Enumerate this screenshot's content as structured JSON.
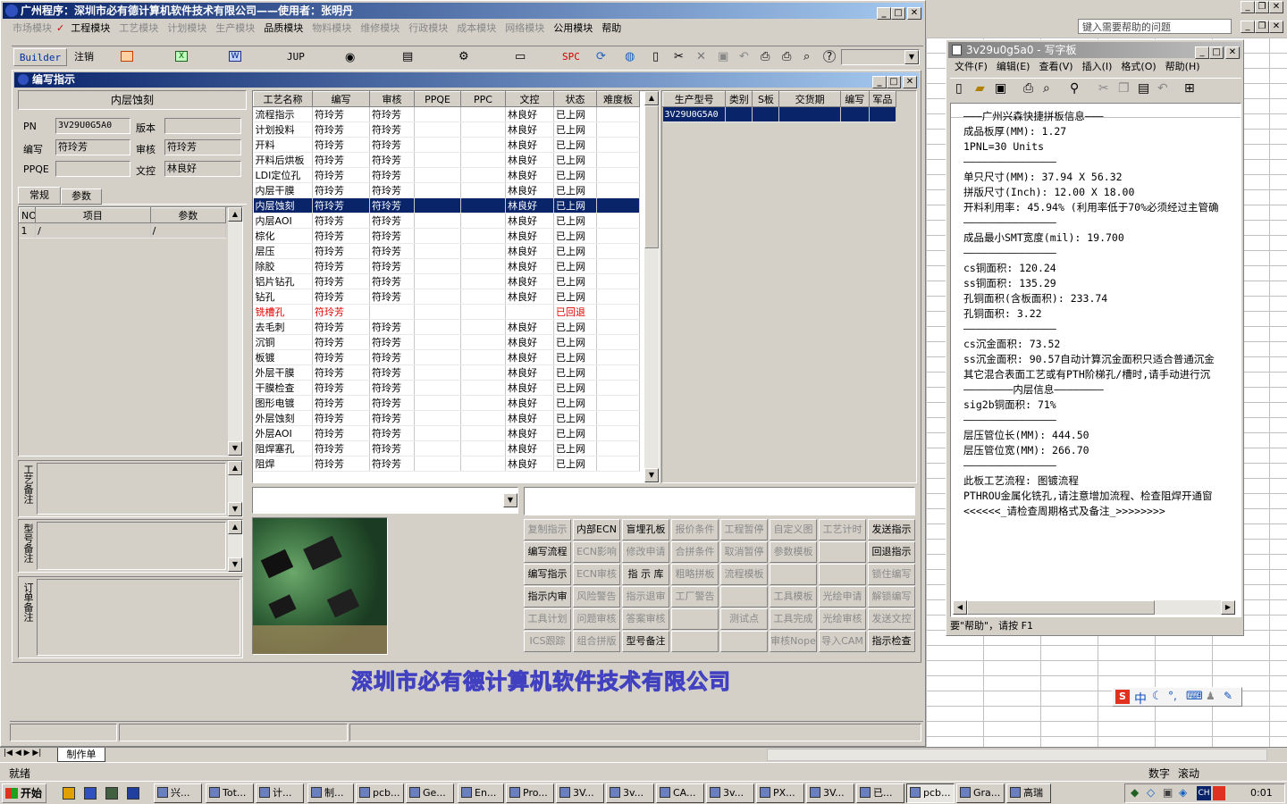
{
  "main_window": {
    "title": "广州程序：深圳市必有德计算机软件技术有限公司——使用者：张明丹",
    "menu": [
      "市场模块",
      "工程模块",
      "工艺模块",
      "计划模块",
      "生产模块",
      "品质模块",
      "物料模块",
      "维修模块",
      "行政模块",
      "成本模块",
      "网络模块",
      "公用模块",
      "帮助"
    ],
    "menu_enabled": [
      false,
      true,
      false,
      false,
      false,
      true,
      false,
      false,
      false,
      false,
      false,
      true,
      true
    ],
    "toolbar": {
      "builder": "Builder",
      "zhuxiao": "注销",
      "jup": "JUP",
      "spc": "SPC"
    }
  },
  "editor": {
    "title": "编写指示",
    "process_label": "内层蚀刻",
    "form": {
      "pn_label": "PN",
      "pn_value": "3V29U0G5A0",
      "version_label": "版本",
      "version_value": "",
      "writer_label": "编写",
      "writer_value": "符玲芳",
      "reviewer_label": "审核",
      "reviewer_value": "符玲芳",
      "ppqe_label": "PPQE",
      "ppqe_value": "",
      "wenkong_label": "文控",
      "wenkong_value": "林良好"
    },
    "tabs": [
      "常规",
      "参数"
    ],
    "param_table": {
      "headers": [
        "NO",
        "项目",
        "参数"
      ],
      "rows": [
        [
          "1",
          "/",
          "/"
        ]
      ]
    },
    "notes": [
      "工艺备注",
      "型号备注",
      "订单备注"
    ]
  },
  "process_table": {
    "headers": [
      "工艺名称",
      "编写",
      "审核",
      "PPQE",
      "PPC",
      "文控",
      "状态",
      "难度板"
    ],
    "rows": [
      {
        "name": "流程指示",
        "writer": "符玲芳",
        "reviewer": "符玲芳",
        "ppqe": "",
        "ppc": "",
        "wenkong": "林良好",
        "status": "已上网",
        "difficulty": ""
      },
      {
        "name": "计划投料",
        "writer": "符玲芳",
        "reviewer": "符玲芳",
        "ppqe": "",
        "ppc": "",
        "wenkong": "林良好",
        "status": "已上网",
        "difficulty": ""
      },
      {
        "name": "开料",
        "writer": "符玲芳",
        "reviewer": "符玲芳",
        "ppqe": "",
        "ppc": "",
        "wenkong": "林良好",
        "status": "已上网",
        "difficulty": ""
      },
      {
        "name": "开料后烘板",
        "writer": "符玲芳",
        "reviewer": "符玲芳",
        "ppqe": "",
        "ppc": "",
        "wenkong": "林良好",
        "status": "已上网",
        "difficulty": ""
      },
      {
        "name": "LDI定位孔",
        "writer": "符玲芳",
        "reviewer": "符玲芳",
        "ppqe": "",
        "ppc": "",
        "wenkong": "林良好",
        "status": "已上网",
        "difficulty": ""
      },
      {
        "name": "内层干膜",
        "writer": "符玲芳",
        "reviewer": "符玲芳",
        "ppqe": "",
        "ppc": "",
        "wenkong": "林良好",
        "status": "已上网",
        "difficulty": ""
      },
      {
        "name": "内层蚀刻",
        "writer": "符玲芳",
        "reviewer": "符玲芳",
        "ppqe": "",
        "ppc": "",
        "wenkong": "林良好",
        "status": "已上网",
        "difficulty": "",
        "selected": true
      },
      {
        "name": "内层AOI",
        "writer": "符玲芳",
        "reviewer": "符玲芳",
        "ppqe": "",
        "ppc": "",
        "wenkong": "林良好",
        "status": "已上网",
        "difficulty": ""
      },
      {
        "name": "棕化",
        "writer": "符玲芳",
        "reviewer": "符玲芳",
        "ppqe": "",
        "ppc": "",
        "wenkong": "林良好",
        "status": "已上网",
        "difficulty": ""
      },
      {
        "name": "层压",
        "writer": "符玲芳",
        "reviewer": "符玲芳",
        "ppqe": "",
        "ppc": "",
        "wenkong": "林良好",
        "status": "已上网",
        "difficulty": ""
      },
      {
        "name": "除胶",
        "writer": "符玲芳",
        "reviewer": "符玲芳",
        "ppqe": "",
        "ppc": "",
        "wenkong": "林良好",
        "status": "已上网",
        "difficulty": ""
      },
      {
        "name": "铝片钻孔",
        "writer": "符玲芳",
        "reviewer": "符玲芳",
        "ppqe": "",
        "ppc": "",
        "wenkong": "林良好",
        "status": "已上网",
        "difficulty": ""
      },
      {
        "name": "钻孔",
        "writer": "符玲芳",
        "reviewer": "符玲芳",
        "ppqe": "",
        "ppc": "",
        "wenkong": "林良好",
        "status": "已上网",
        "difficulty": ""
      },
      {
        "name": "铣槽孔",
        "writer": "符玲芳",
        "reviewer": "",
        "ppqe": "",
        "ppc": "",
        "wenkong": "",
        "status": "已回退",
        "difficulty": "",
        "red": true
      },
      {
        "name": "去毛刺",
        "writer": "符玲芳",
        "reviewer": "符玲芳",
        "ppqe": "",
        "ppc": "",
        "wenkong": "林良好",
        "status": "已上网",
        "difficulty": ""
      },
      {
        "name": "沉铜",
        "writer": "符玲芳",
        "reviewer": "符玲芳",
        "ppqe": "",
        "ppc": "",
        "wenkong": "林良好",
        "status": "已上网",
        "difficulty": ""
      },
      {
        "name": "板镀",
        "writer": "符玲芳",
        "reviewer": "符玲芳",
        "ppqe": "",
        "ppc": "",
        "wenkong": "林良好",
        "status": "已上网",
        "difficulty": ""
      },
      {
        "name": "外层干膜",
        "writer": "符玲芳",
        "reviewer": "符玲芳",
        "ppqe": "",
        "ppc": "",
        "wenkong": "林良好",
        "status": "已上网",
        "difficulty": ""
      },
      {
        "name": "干膜检查",
        "writer": "符玲芳",
        "reviewer": "符玲芳",
        "ppqe": "",
        "ppc": "",
        "wenkong": "林良好",
        "status": "已上网",
        "difficulty": ""
      },
      {
        "name": "图形电镀",
        "writer": "符玲芳",
        "reviewer": "符玲芳",
        "ppqe": "",
        "ppc": "",
        "wenkong": "林良好",
        "status": "已上网",
        "difficulty": ""
      },
      {
        "name": "外层蚀刻",
        "writer": "符玲芳",
        "reviewer": "符玲芳",
        "ppqe": "",
        "ppc": "",
        "wenkong": "林良好",
        "status": "已上网",
        "difficulty": ""
      },
      {
        "name": "外层AOI",
        "writer": "符玲芳",
        "reviewer": "符玲芳",
        "ppqe": "",
        "ppc": "",
        "wenkong": "林良好",
        "status": "已上网",
        "difficulty": ""
      },
      {
        "name": "阻焊塞孔",
        "writer": "符玲芳",
        "reviewer": "符玲芳",
        "ppqe": "",
        "ppc": "",
        "wenkong": "林良好",
        "status": "已上网",
        "difficulty": ""
      },
      {
        "name": "阻焊",
        "writer": "符玲芳",
        "reviewer": "符玲芳",
        "ppqe": "",
        "ppc": "",
        "wenkong": "林良好",
        "status": "已上网",
        "difficulty": ""
      }
    ]
  },
  "model_table": {
    "headers": [
      "生产型号",
      "类别",
      "S板",
      "交货期",
      "编写",
      "军品"
    ],
    "rows": [
      [
        "3V29U0G5A0",
        "",
        "",
        "",
        "",
        ""
      ]
    ]
  },
  "buttons": [
    {
      "label": "复制指示",
      "enabled": false
    },
    {
      "label": "内部ECN",
      "enabled": true
    },
    {
      "label": "盲埋孔板",
      "enabled": true
    },
    {
      "label": "报价条件",
      "enabled": false
    },
    {
      "label": "工程暂停",
      "enabled": false
    },
    {
      "label": "自定义图",
      "enabled": false
    },
    {
      "label": "工艺计时",
      "enabled": false
    },
    {
      "label": "发送指示",
      "enabled": true
    },
    {
      "label": "编写流程",
      "enabled": true
    },
    {
      "label": "ECN影响",
      "enabled": false
    },
    {
      "label": "修改申请",
      "enabled": false
    },
    {
      "label": "合拼条件",
      "enabled": false
    },
    {
      "label": "取消暂停",
      "enabled": false
    },
    {
      "label": "参数模板",
      "enabled": false
    },
    {
      "label": "",
      "enabled": false
    },
    {
      "label": "回退指示",
      "enabled": true
    },
    {
      "label": "编写指示",
      "enabled": true
    },
    {
      "label": "ECN审核",
      "enabled": false
    },
    {
      "label": "指 示 库",
      "enabled": true
    },
    {
      "label": "粗略拼板",
      "enabled": false
    },
    {
      "label": "流程模板",
      "enabled": false
    },
    {
      "label": "",
      "enabled": false
    },
    {
      "label": "",
      "enabled": false
    },
    {
      "label": "锁住编写",
      "enabled": false
    },
    {
      "label": "指示内审",
      "enabled": true
    },
    {
      "label": "风险警告",
      "enabled": false
    },
    {
      "label": "指示退审",
      "enabled": false
    },
    {
      "label": "工厂警告",
      "enabled": false
    },
    {
      "label": "",
      "enabled": false
    },
    {
      "label": "工具模板",
      "enabled": false
    },
    {
      "label": "光绘申请",
      "enabled": false
    },
    {
      "label": "解锁编写",
      "enabled": false
    },
    {
      "label": "工具计划",
      "enabled": false
    },
    {
      "label": "问题审核",
      "enabled": false
    },
    {
      "label": "答案审核",
      "enabled": false
    },
    {
      "label": "",
      "enabled": false
    },
    {
      "label": "测试点",
      "enabled": false
    },
    {
      "label": "工具完成",
      "enabled": false
    },
    {
      "label": "光绘审核",
      "enabled": false
    },
    {
      "label": "发送文控",
      "enabled": false
    },
    {
      "label": "ICS跟踪",
      "enabled": false
    },
    {
      "label": "组合拼版",
      "enabled": false
    },
    {
      "label": "型号备注",
      "enabled": true
    },
    {
      "label": "",
      "enabled": false
    },
    {
      "label": "",
      "enabled": false
    },
    {
      "label": "审核Nope",
      "enabled": false
    },
    {
      "label": "导入CAM",
      "enabled": false
    },
    {
      "label": "指示检查",
      "enabled": true
    }
  ],
  "watermark": "深圳市必有德计算机软件技术有限公司",
  "excel": {
    "help_box": "键入需要帮助的问题",
    "sheet_tab": "制作单",
    "status_left": "就绪",
    "status_right": [
      "数字",
      "滚动"
    ]
  },
  "wordpad": {
    "title": "3v29u0g5a0 - 写字板",
    "menu": [
      "文件(F)",
      "编辑(E)",
      "查看(V)",
      "插入(I)",
      "格式(O)",
      "帮助(H)"
    ],
    "lines": [
      "———广州兴森快捷拼板信息———",
      "成品板厚(MM): 1.27",
      "1PNL=30 Units",
      "———————————————",
      "单只尺寸(MM): 37.94 X 56.32",
      "拼版尺寸(Inch): 12.00 X 18.00",
      "开料利用率: 45.94% (利用率低于70%必须经过主管确",
      "———————————————",
      "成品最小SMT宽度(mil): 19.700",
      "———————————————",
      "cs铜面积: 120.24",
      "ss铜面积: 135.29",
      "孔铜面积(含板面积): 233.74",
      "孔铜面积: 3.22",
      "———————————————",
      "cs沉金面积: 73.52",
      "ss沉金面积: 90.57自动计算沉金面积只适合普通沉金",
      "其它混合表面工艺或有PTH阶梯孔/槽时,请手动进行沉",
      "————————内层信息————————",
      "sig2b铜面积: 71%",
      "———————————————",
      "层压管位长(MM): 444.50",
      "层压管位宽(MM): 266.70",
      "———————————————",
      "此板工艺流程: 图镀流程",
      "PTHROU金属化铣孔,请注意增加流程、检查阻焊开通窗",
      "<<<<<<_请检查周期格式及备注_>>>>>>>>"
    ],
    "status": "要\"帮助\"，请按 F1"
  },
  "ime": {
    "label": "中"
  },
  "taskbar": {
    "start": "开始",
    "items": [
      "兴...",
      "Tot...",
      "计...",
      "制...",
      "pcb...",
      "Ge...",
      "En...",
      "Pro...",
      "3V...",
      "3v...",
      "CA...",
      "3v...",
      "PX...",
      "3V...",
      "已...",
      "pcb...",
      "Gra...",
      "高瑞"
    ],
    "clock": "0:01",
    "tray": "CH"
  }
}
